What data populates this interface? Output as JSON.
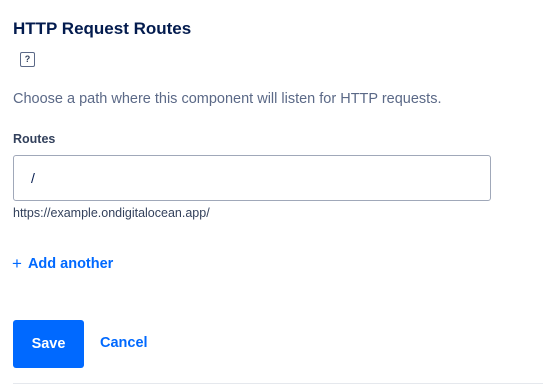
{
  "section": {
    "title": "HTTP Request Routes",
    "help_icon": "question-mark-icon",
    "help_glyph": "?",
    "description": "Choose a path where this component will listen for HTTP requests."
  },
  "routes": {
    "label": "Routes",
    "items": [
      {
        "value": "/",
        "hint": "https://example.ondigitalocean.app/"
      }
    ],
    "add_icon": "plus-icon",
    "add_glyph": "+",
    "add_label": "Add another"
  },
  "actions": {
    "save_label": "Save",
    "cancel_label": "Cancel"
  },
  "colors": {
    "accent": "#0069ff",
    "heading": "#031b4e",
    "muted_text": "#5b6987",
    "input_border": "#a0a8b9"
  }
}
